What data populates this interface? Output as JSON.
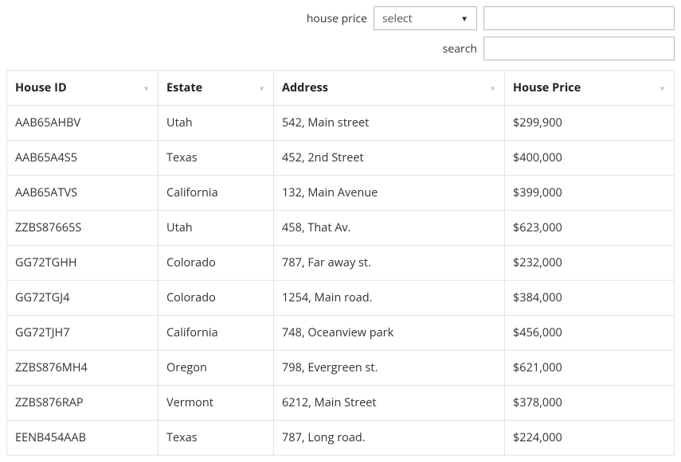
{
  "filters": {
    "price_label": "house price",
    "price_select_placeholder": "select",
    "search_label": "search"
  },
  "table": {
    "headers": {
      "id": "House ID",
      "estate": "Estate",
      "address": "Address",
      "price": "House Price"
    },
    "rows": [
      {
        "id": "AAB65AHBV",
        "estate": "Utah",
        "address": "542, Main street",
        "price": "$299,900"
      },
      {
        "id": "AAB65A4S5",
        "estate": "Texas",
        "address": "452, 2nd Street",
        "price": "$400,000"
      },
      {
        "id": "AAB65ATVS",
        "estate": "California",
        "address": "132, Main Avenue",
        "price": "$399,000"
      },
      {
        "id": "ZZBS87665S",
        "estate": "Utah",
        "address": "458, That Av.",
        "price": "$623,000"
      },
      {
        "id": "GG72TGHH",
        "estate": "Colorado",
        "address": "787, Far away st.",
        "price": "$232,000"
      },
      {
        "id": "GG72TGJ4",
        "estate": "Colorado",
        "address": "1254, Main road.",
        "price": "$384,000"
      },
      {
        "id": "GG72TJH7",
        "estate": "California",
        "address": "748, Oceanview park",
        "price": "$456,000"
      },
      {
        "id": "ZZBS876MH4",
        "estate": "Oregon",
        "address": "798, Evergreen st.",
        "price": "$621,000"
      },
      {
        "id": "ZZBS876RAP",
        "estate": "Vermont",
        "address": "6212, Main Street",
        "price": "$378,000"
      },
      {
        "id": "EENB454AAB",
        "estate": "Texas",
        "address": "787, Long road.",
        "price": "$224,000"
      }
    ]
  }
}
